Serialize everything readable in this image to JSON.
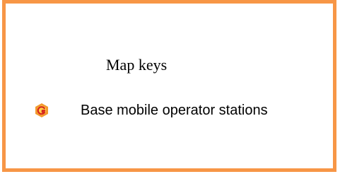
{
  "legend": {
    "title": "Map keys",
    "frame_color": "#f79646",
    "items": [
      {
        "icon": "base-station-marker-icon",
        "icon_colors": {
          "outer": "#f29a2e",
          "inner": "#d7261e",
          "highlight": "#ffd24a"
        },
        "label": "Base mobile operator stations"
      }
    ]
  }
}
